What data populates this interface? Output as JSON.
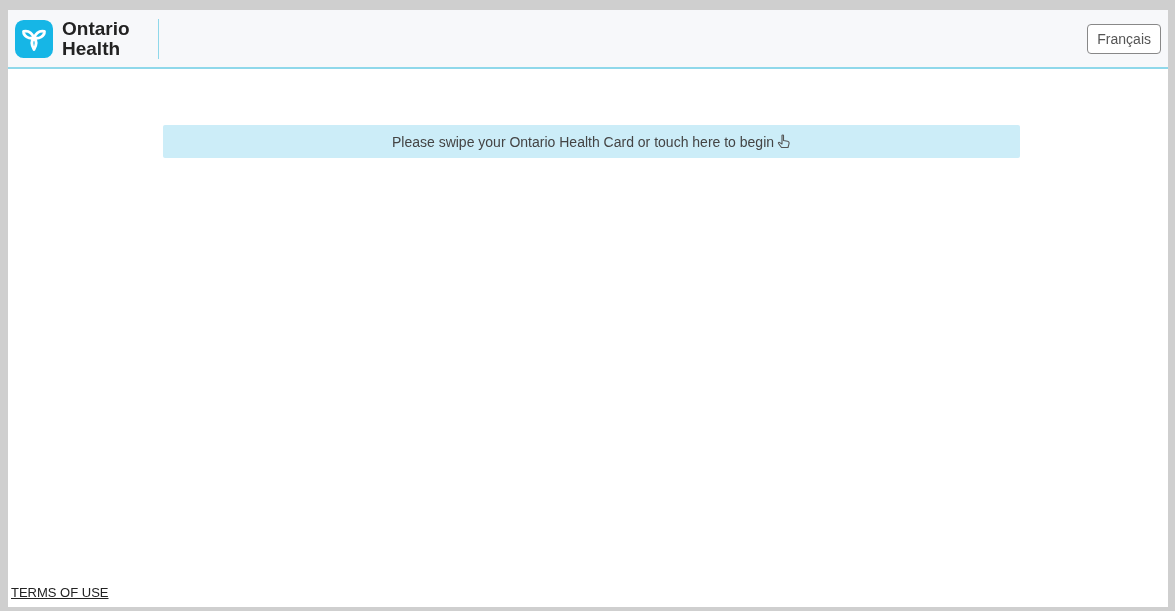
{
  "header": {
    "brand_line_1": "Ontario",
    "brand_line_2": "Health",
    "language_button": "Français"
  },
  "prompt": {
    "text": "Please swipe your Ontario Health Card or touch here to begin"
  },
  "footer": {
    "terms_link": "TERMS OF USE"
  }
}
